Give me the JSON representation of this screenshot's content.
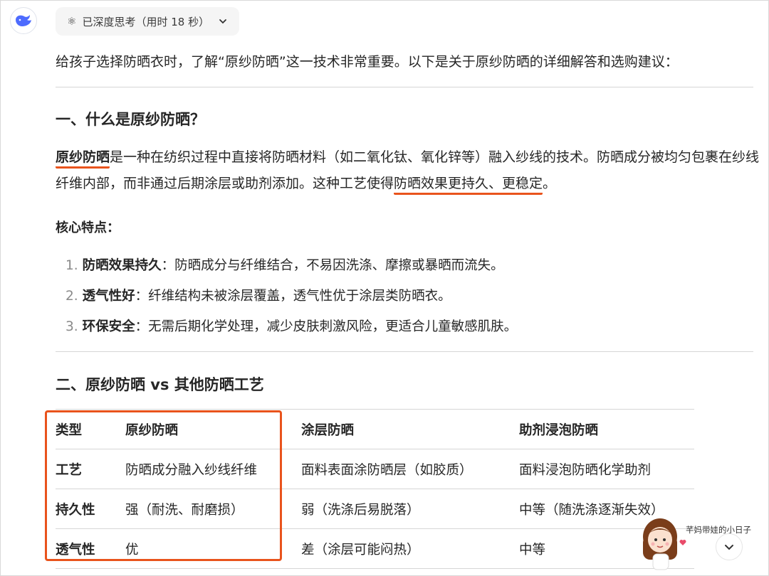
{
  "thinking": {
    "label": "已深度思考（用时 18 秒）"
  },
  "intro": "给孩子选择防晒衣时，了解“原纱防晒”这一技术非常重要。以下是关于原纱防晒的详细解答和选购建议：",
  "section1": {
    "title": "一、什么是原纱防晒？",
    "term": "原纱防晒",
    "p1": "是一种在纺织过程中直接将防晒材料（如二氧化钛、氧化锌等）融入纱线的技术。防晒成分被均匀包裹在纱线纤维内部，而非通过后期涂层或助剂添加。这种工艺使得",
    "p1_emph": "防晒效果更持久、更稳定",
    "p1_end": "。",
    "features_title": "核心特点：",
    "features": [
      {
        "num": "1.",
        "title": "防晒效果持久",
        "text": "：防晒成分与纤维结合，不易因洗涤、摩擦或暴晒而流失。"
      },
      {
        "num": "2.",
        "title": "透气性好",
        "text": "：纤维结构未被涂层覆盖，透气性优于涂层类防晒衣。"
      },
      {
        "num": "3.",
        "title": "环保安全",
        "text": "：无需后期化学处理，减少皮肤刺激风险，更适合儿童敏感肌肤。"
      }
    ]
  },
  "section2": {
    "title": "二、原纱防晒 vs 其他防晒工艺",
    "table": {
      "headers": [
        "类型",
        "原纱防晒",
        "涂层防晒",
        "助剂浸泡防晒"
      ],
      "rows": [
        [
          "工艺",
          "防晒成分融入纱线纤维",
          "面料表面涂防晒层（如胶质）",
          "面料浸泡防晒化学助剂"
        ],
        [
          "持久性",
          "强（耐洗、耐磨损）",
          "弱（洗涤后易脱落）",
          "中等（随洗涤逐渐失效）"
        ],
        [
          "透气性",
          "优",
          "差（涂层可能闷热）",
          "中等"
        ]
      ]
    }
  },
  "watermark": {
    "text": "芊妈带娃的小日子"
  },
  "colors": {
    "annotation": "#e9531c",
    "brand": "#4d6bfe"
  }
}
